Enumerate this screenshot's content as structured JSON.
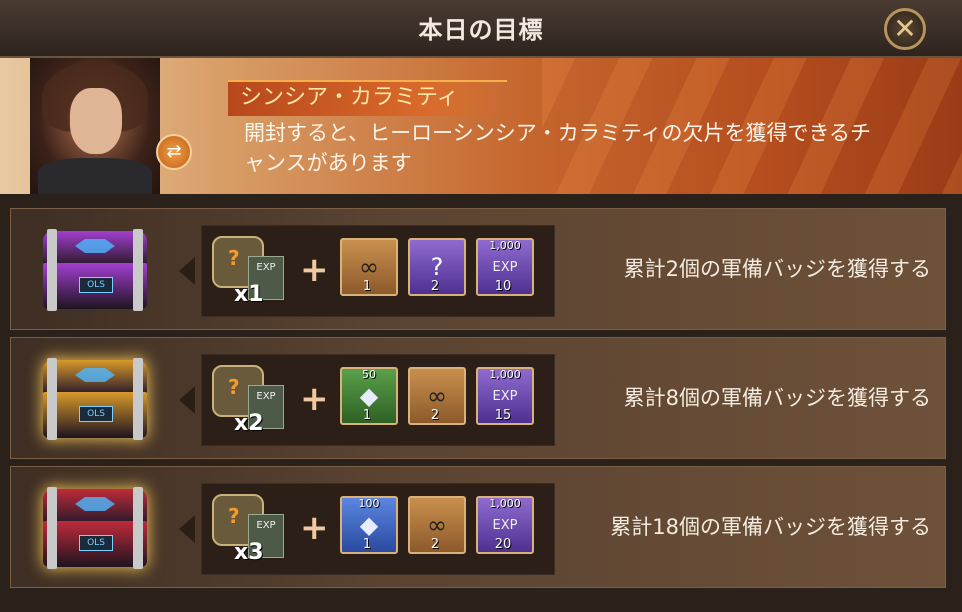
{
  "title": "本日の目標",
  "close_icon": "close-x-icon",
  "hero": {
    "name": "シンシア・カラミティ",
    "description": "開封すると、ヒーローシンシア・カラミティの欠片を獲得できるチャンスがあります",
    "swap_icon": "swap-icon"
  },
  "rows": [
    {
      "chest_color": "#a23fd0",
      "piece_label": "?",
      "book_label": "EXP",
      "multiplier": "x1",
      "plus": "+",
      "items": [
        {
          "icon": "binoculars-icon",
          "bg": "orange",
          "top": "",
          "count": "1"
        },
        {
          "icon": "mystery-puzzle-icon",
          "bg": "purple",
          "top": "",
          "count": "2"
        },
        {
          "icon": "exp-book-icon",
          "bg": "purple",
          "top": "1,000",
          "count": "10"
        }
      ],
      "task": "累計2個の軍備バッジを獲得する"
    },
    {
      "chest_color": "#d89a2a",
      "piece_label": "?",
      "book_label": "EXP",
      "multiplier": "x2",
      "plus": "+",
      "items": [
        {
          "icon": "diamond-icon",
          "bg": "green",
          "top": "50",
          "count": "1"
        },
        {
          "icon": "binoculars-icon",
          "bg": "orange",
          "top": "",
          "count": "2"
        },
        {
          "icon": "exp-book-icon",
          "bg": "purple",
          "top": "1,000",
          "count": "15"
        }
      ],
      "task": "累計8個の軍備バッジを獲得する"
    },
    {
      "chest_color": "#c02a3a",
      "piece_label": "?",
      "book_label": "EXP",
      "multiplier": "x3",
      "plus": "+",
      "items": [
        {
          "icon": "diamond-icon",
          "bg": "blue",
          "top": "100",
          "count": "1"
        },
        {
          "icon": "binoculars-icon",
          "bg": "orange",
          "top": "",
          "count": "2"
        },
        {
          "icon": "exp-book-icon",
          "bg": "purple",
          "top": "1,000",
          "count": "20"
        }
      ],
      "task": "累計18個の軍備バッジを獲得する"
    }
  ]
}
